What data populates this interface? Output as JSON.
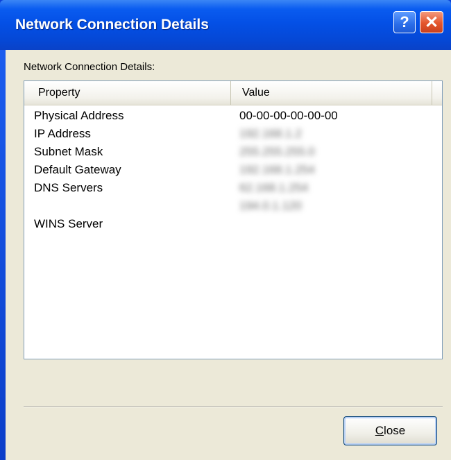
{
  "window": {
    "title": "Network Connection Details",
    "help_glyph": "?",
    "close_glyph": "✕"
  },
  "group_label": "Network Connection Details:",
  "columns": {
    "property": "Property",
    "value": "Value"
  },
  "rows": [
    {
      "property": "Physical Address",
      "value": "00-00-00-00-00-00"
    },
    {
      "property": "IP Address",
      "value": "192.168.1.2"
    },
    {
      "property": "Subnet Mask",
      "value": "255.255.255.0"
    },
    {
      "property": "Default Gateway",
      "value": "192.168.1.254"
    },
    {
      "property": "DNS Servers",
      "value": "62.168.1.254"
    },
    {
      "property": "",
      "value": "194.0.1.120"
    },
    {
      "property": "WINS Server",
      "value": ""
    }
  ],
  "close_button": {
    "label": "Close",
    "mnemonic": "C",
    "rest": "lose"
  },
  "colors": {
    "title_bar": "#0450e6",
    "client_bg": "#ece9d8",
    "close_x_bg": "#e4552c"
  }
}
